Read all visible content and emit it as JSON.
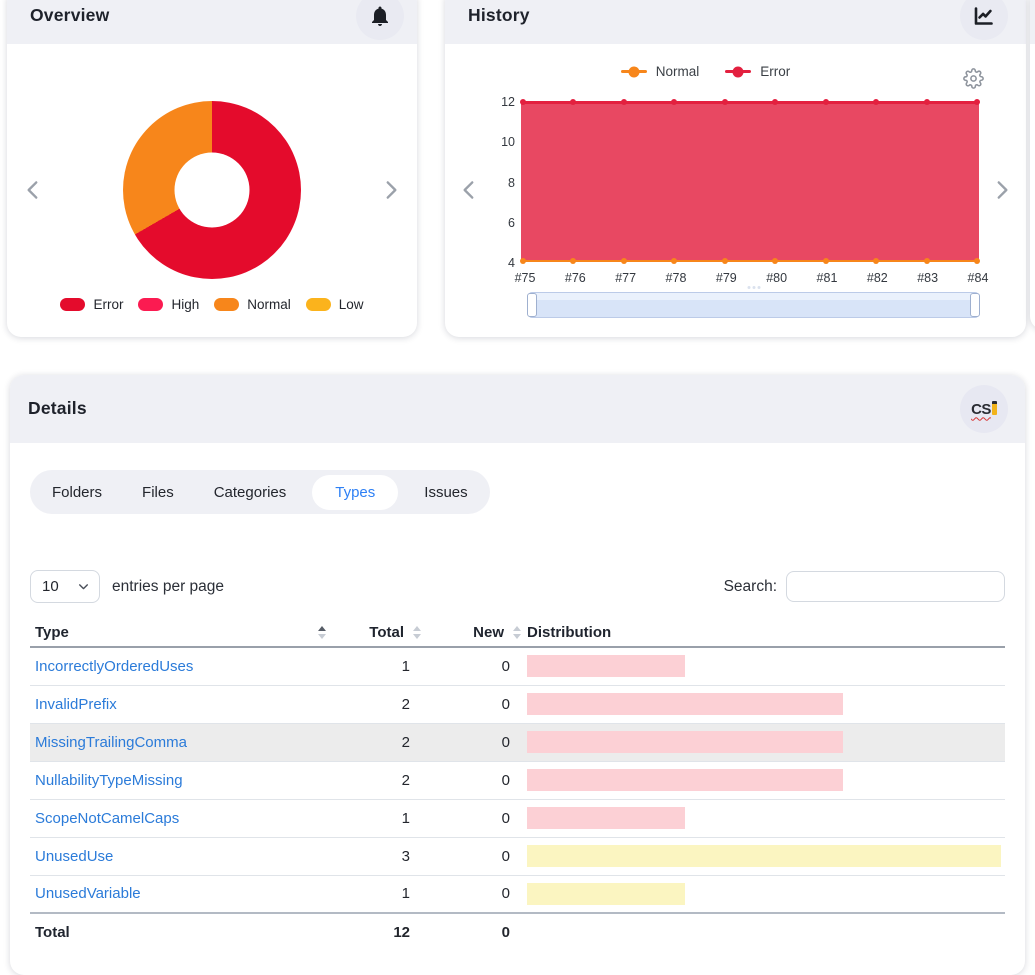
{
  "overview": {
    "title": "Overview",
    "donut": {
      "segments": [
        {
          "label": "Error",
          "value": 8,
          "color": "#e40b2c"
        },
        {
          "label": "Normal",
          "value": 4,
          "color": "#f7861b"
        }
      ]
    },
    "legend": [
      {
        "label": "Error",
        "color": "#e40b2c"
      },
      {
        "label": "High",
        "color": "#fb1b51"
      },
      {
        "label": "Normal",
        "color": "#f7861b"
      },
      {
        "label": "Low",
        "color": "#fbb31c"
      }
    ]
  },
  "history": {
    "title": "History",
    "legend": [
      {
        "label": "Normal",
        "color": "#f7861b"
      },
      {
        "label": "Error",
        "color": "#e3203f"
      }
    ],
    "error_line_color": "#e3203f",
    "error_fill_color": "rgba(227,32,63,0.82)",
    "normal_line_color": "#f7861b",
    "y_ticks": [
      "12",
      "10",
      "8",
      "6",
      "4"
    ],
    "x_labels": [
      "#75",
      "#76",
      "#77",
      "#78",
      "#79",
      "#80",
      "#81",
      "#82",
      "#83",
      "#84"
    ]
  },
  "details": {
    "title": "Details",
    "tabs": [
      {
        "label": "Folders",
        "active": false
      },
      {
        "label": "Files",
        "active": false
      },
      {
        "label": "Categories",
        "active": false
      },
      {
        "label": "Types",
        "active": true
      },
      {
        "label": "Issues",
        "active": false
      }
    ],
    "page_size": "10",
    "entries_label": "entries per page",
    "search_label": "Search:",
    "search_value": "",
    "table": {
      "headers": [
        "Type",
        "Total",
        "New",
        "Distribution"
      ],
      "dist_max": 3,
      "rows": [
        {
          "type": "IncorrectlyOrderedUses",
          "total": "1",
          "new": "0",
          "dist_value": 1,
          "dist_color": "#fcd0d5",
          "highlight": false
        },
        {
          "type": "InvalidPrefix",
          "total": "2",
          "new": "0",
          "dist_value": 2,
          "dist_color": "#fcd0d5",
          "highlight": false
        },
        {
          "type": "MissingTrailingComma",
          "total": "2",
          "new": "0",
          "dist_value": 2,
          "dist_color": "#fcd0d5",
          "highlight": true
        },
        {
          "type": "NullabilityTypeMissing",
          "total": "2",
          "new": "0",
          "dist_value": 2,
          "dist_color": "#fcd0d5",
          "highlight": false
        },
        {
          "type": "ScopeNotCamelCaps",
          "total": "1",
          "new": "0",
          "dist_value": 1,
          "dist_color": "#fcd0d5",
          "highlight": false
        },
        {
          "type": "UnusedUse",
          "total": "3",
          "new": "0",
          "dist_value": 3,
          "dist_color": "#fbf5c1",
          "highlight": false
        },
        {
          "type": "UnusedVariable",
          "total": "1",
          "new": "0",
          "dist_value": 1,
          "dist_color": "#fbf5c1",
          "highlight": false
        }
      ],
      "footer": {
        "label": "Total",
        "total": "12",
        "new": "0"
      }
    }
  },
  "chart_data": [
    {
      "type": "pie",
      "title": "Overview severity distribution",
      "labels": [
        "Error",
        "High",
        "Normal",
        "Low"
      ],
      "values": [
        8,
        0,
        4,
        0
      ],
      "colors": [
        "#e40b2c",
        "#fb1b51",
        "#f7861b",
        "#fbb31c"
      ],
      "donut": true,
      "legend_position": "bottom"
    },
    {
      "type": "area",
      "title": "History",
      "x": [
        "#75",
        "#76",
        "#77",
        "#78",
        "#79",
        "#80",
        "#81",
        "#82",
        "#83",
        "#84"
      ],
      "series": [
        {
          "name": "Normal",
          "color": "#f7861b",
          "values": [
            4,
            4,
            4,
            4,
            4,
            4,
            4,
            4,
            4,
            4
          ]
        },
        {
          "name": "Error",
          "color": "#e3203f",
          "values": [
            8,
            8,
            8,
            8,
            8,
            8,
            8,
            8,
            8,
            8
          ]
        }
      ],
      "stacked": true,
      "ylim": [
        4,
        12
      ],
      "y_ticks": [
        4,
        6,
        8,
        10,
        12
      ],
      "legend_position": "top",
      "grid": false,
      "has_scrollbar": true
    }
  ]
}
